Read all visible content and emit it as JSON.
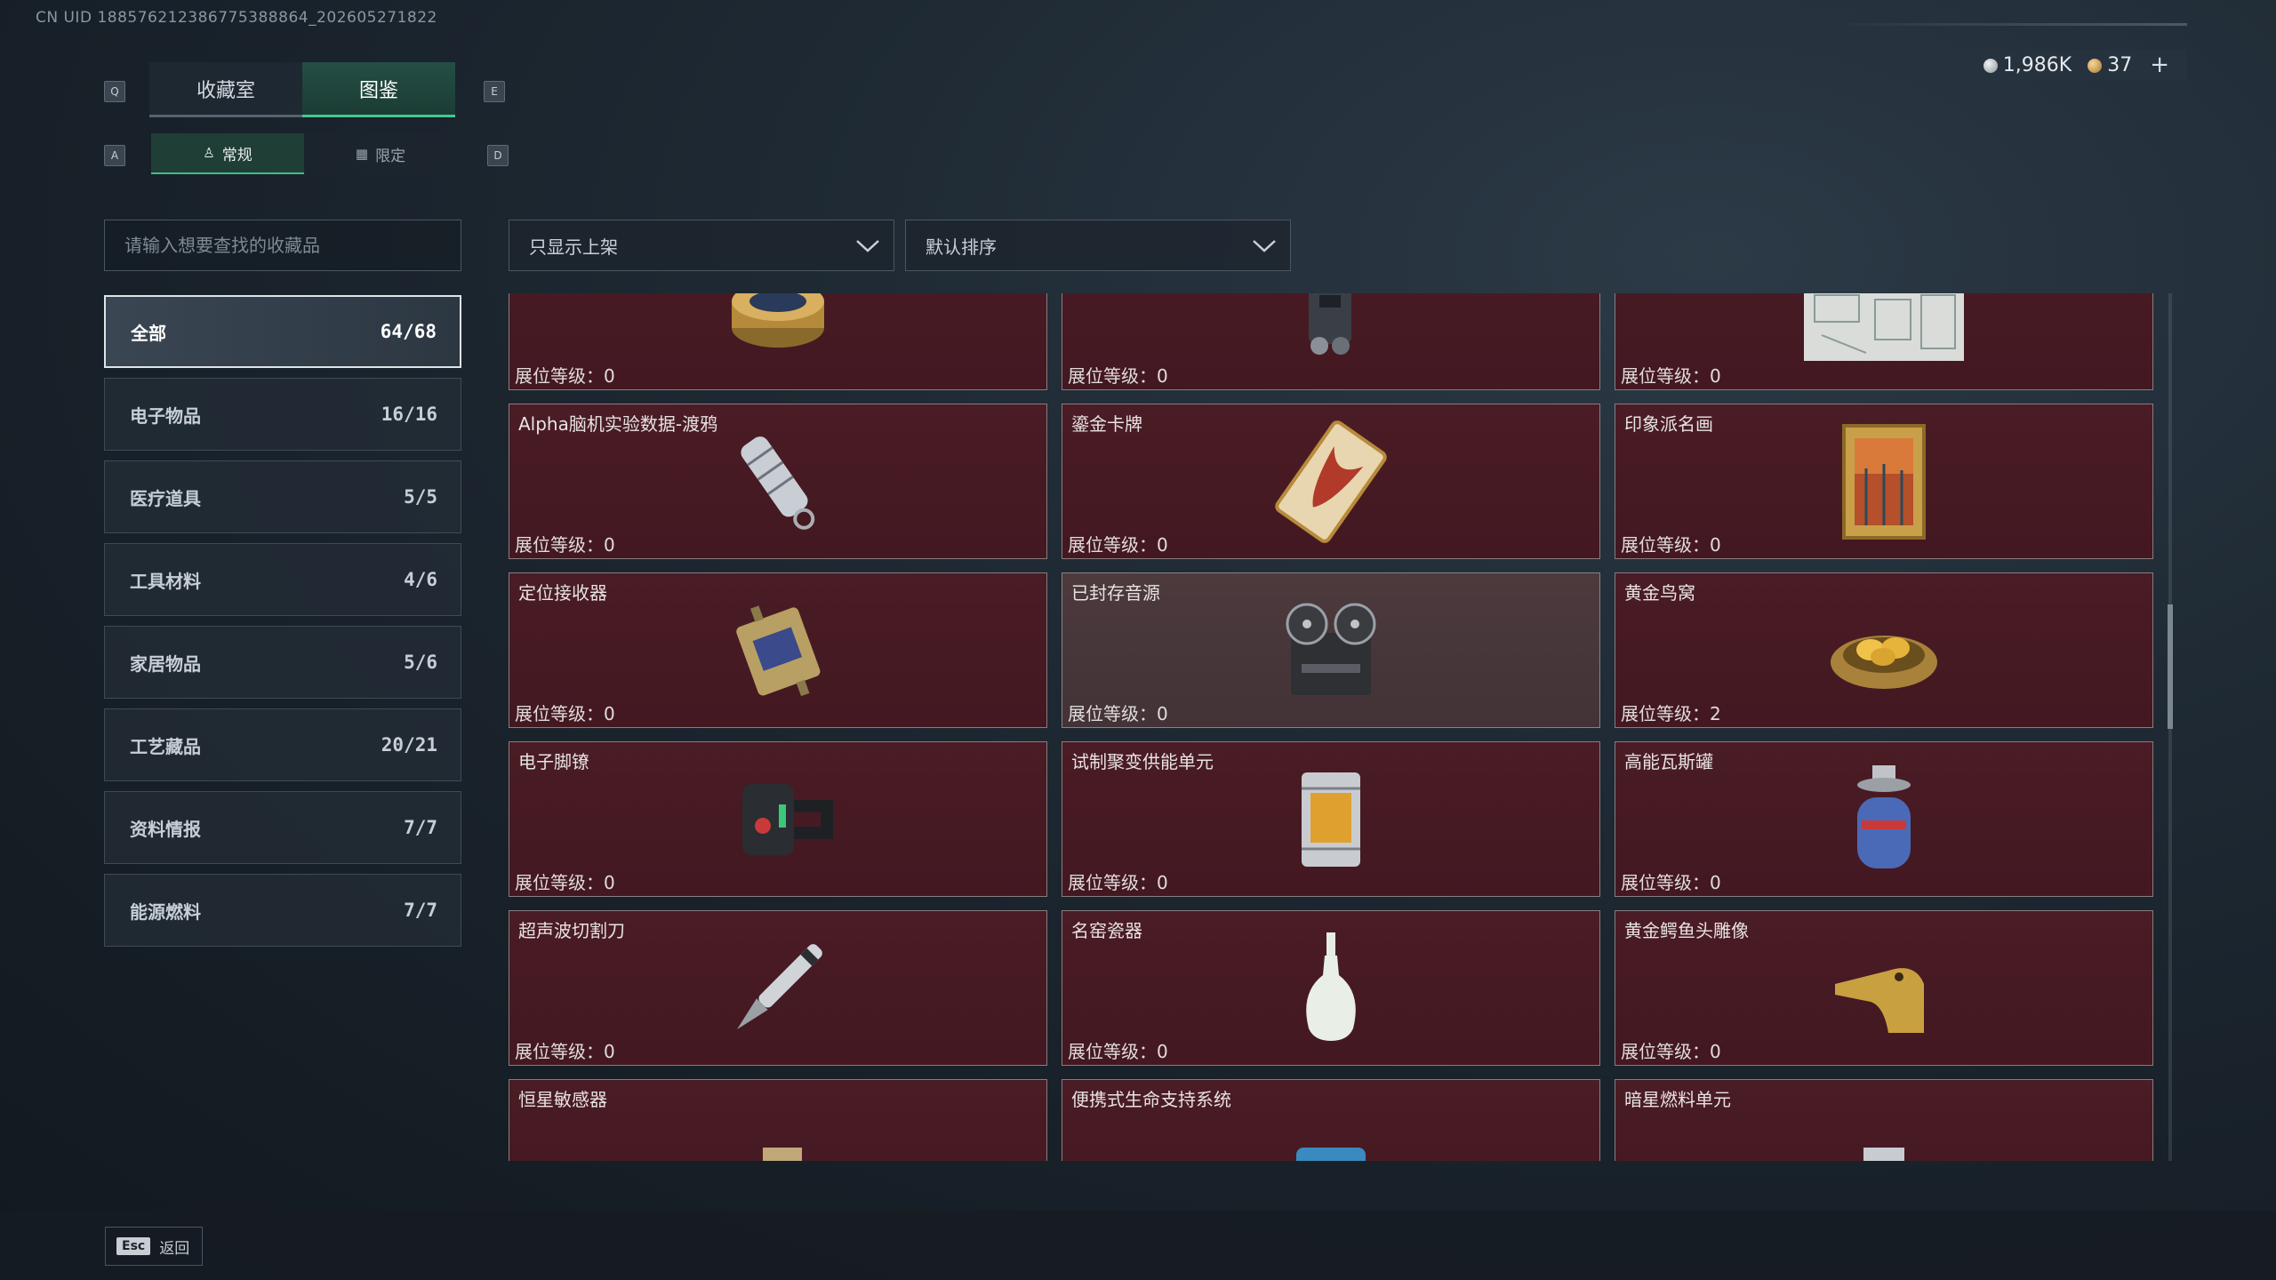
{
  "uid_text": "CN UID 188576212386775388864_202605271822",
  "currency": {
    "silver": "1,986K",
    "gold": "37",
    "add": "+"
  },
  "keys": {
    "prev_tab": "Q",
    "next_tab": "E",
    "prev_sub": "A",
    "next_sub": "D"
  },
  "tabs": [
    {
      "label": "收藏室",
      "active": false
    },
    {
      "label": "图鉴",
      "active": true
    }
  ],
  "subtabs": [
    {
      "label": "常规",
      "icon": "bottle-icon",
      "active": true
    },
    {
      "label": "限定",
      "icon": "image-icon",
      "active": false
    }
  ],
  "search": {
    "placeholder": "请输入想要查找的收藏品"
  },
  "filters": {
    "shelf": "只显示上架",
    "sort": "默认排序"
  },
  "categories": [
    {
      "label": "全部",
      "count": "64/68",
      "active": true
    },
    {
      "label": "电子物品",
      "count": "16/16"
    },
    {
      "label": "医疗道具",
      "count": "5/5"
    },
    {
      "label": "工具材料",
      "count": "4/6"
    },
    {
      "label": "家居物品",
      "count": "5/6"
    },
    {
      "label": "工艺藏品",
      "count": "20/21"
    },
    {
      "label": "资料情报",
      "count": "7/7"
    },
    {
      "label": "能源燃料",
      "count": "7/7"
    }
  ],
  "level_prefix": "展位等级：",
  "items": [
    {
      "name": "",
      "level": "0",
      "icon": "caviar-tin-icon"
    },
    {
      "name": "",
      "level": "0",
      "icon": "device-icon"
    },
    {
      "name": "",
      "level": "0",
      "icon": "blueprint-map-icon"
    },
    {
      "name": "Alpha脑机实验数据-渡鸦",
      "level": "0",
      "icon": "data-capsule-icon"
    },
    {
      "name": "鎏金卡牌",
      "level": "0",
      "icon": "gilded-card-icon"
    },
    {
      "name": "印象派名画",
      "level": "0",
      "icon": "framed-painting-icon"
    },
    {
      "name": "定位接收器",
      "level": "0",
      "icon": "receiver-icon"
    },
    {
      "name": "已封存音源",
      "level": "0",
      "icon": "reel-recorder-icon",
      "dim": true
    },
    {
      "name": "黄金鸟窝",
      "level": "2",
      "icon": "golden-nest-icon"
    },
    {
      "name": "电子脚镣",
      "level": "0",
      "icon": "ankle-monitor-icon"
    },
    {
      "name": "试制聚变供能单元",
      "level": "0",
      "icon": "fusion-cell-icon"
    },
    {
      "name": "高能瓦斯罐",
      "level": "0",
      "icon": "gas-canister-icon"
    },
    {
      "name": "超声波切割刀",
      "level": "0",
      "icon": "ultrasonic-knife-icon"
    },
    {
      "name": "名窑瓷器",
      "level": "0",
      "icon": "porcelain-vase-icon"
    },
    {
      "name": "黄金鳄鱼头雕像",
      "level": "0",
      "icon": "gold-croc-statue-icon"
    },
    {
      "name": "恒星敏感器",
      "level": "",
      "icon": "star-sensor-icon"
    },
    {
      "name": "便携式生命支持系统",
      "level": "",
      "icon": "life-support-icon"
    },
    {
      "name": "暗星燃料单元",
      "level": "",
      "icon": "fuel-cell-icon"
    }
  ],
  "footer": {
    "esc_key": "Esc",
    "back_label": "返回"
  }
}
